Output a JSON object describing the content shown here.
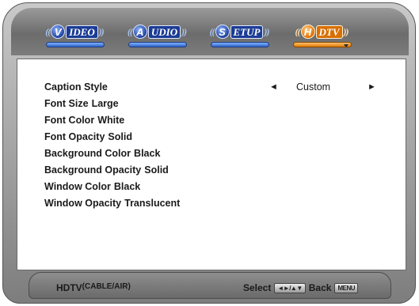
{
  "tabs": [
    {
      "letter": "V",
      "rest": "IDEO",
      "active": false
    },
    {
      "letter": "A",
      "rest": "UDIO",
      "active": false
    },
    {
      "letter": "S",
      "rest": "ETUP",
      "active": false
    },
    {
      "letter": "H",
      "rest": "DTV",
      "active": true
    }
  ],
  "menu": {
    "caption_style": {
      "label": "Caption Style",
      "value": "Custom"
    },
    "font_size": {
      "label": "Font Size",
      "value": "Large"
    },
    "font_color": {
      "label": "Font Color",
      "value": "White"
    },
    "font_opacity": {
      "label": "Font Opacity",
      "value": "Solid"
    },
    "background_color": {
      "label": "Background Color",
      "value": "Black"
    },
    "background_opacity": {
      "label": "Background Opacity",
      "value": "Solid"
    },
    "window_color": {
      "label": "Window Color",
      "value": "Black"
    },
    "window_opacity": {
      "label": "Window Opacity",
      "value": "Translucent"
    }
  },
  "footer": {
    "source": "HDTV",
    "source_detail": "(CABLE/AIR)",
    "select_label": "Select",
    "select_keys": "◄►/▲▼",
    "back_label": "Back",
    "back_key": "MENU"
  },
  "colors": {
    "tab_blue": "#1b3c95",
    "tab_active_orange": "#d86f00",
    "frame_gray": "#7d7d7d"
  },
  "icons": {
    "prev": "left-arrow-icon",
    "next": "right-arrow-icon"
  }
}
